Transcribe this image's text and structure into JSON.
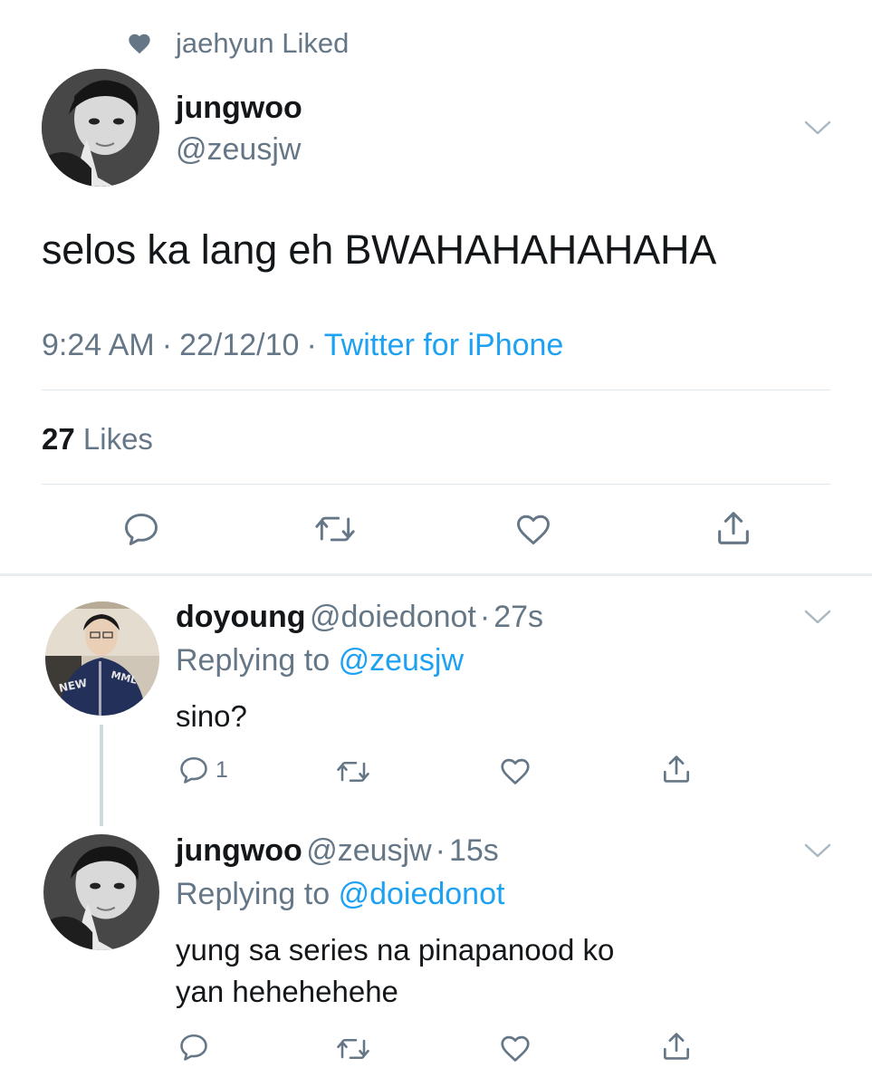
{
  "social_context": {
    "text": "jaehyun Liked",
    "icon": "heart-icon"
  },
  "main_tweet": {
    "name": "jungwoo",
    "handle": "@zeusjw",
    "text": "selos ka lang eh BWAHAHAHAHAHA",
    "time": "9:24 AM",
    "date": "22/12/10",
    "separator": "·",
    "source": "Twitter for iPhone",
    "likes_count": "27",
    "likes_label": "Likes"
  },
  "replies": [
    {
      "name": "doyoung",
      "handle": "@doiedonot",
      "sep": "·",
      "time": "27s",
      "replying_label": "Replying to",
      "replying_to": "@zeusjw",
      "text": "sino?",
      "reply_count": "1",
      "avatar_text_left": "NEW",
      "avatar_text_right": "MML"
    },
    {
      "name": "jungwoo",
      "handle": "@zeusjw",
      "sep": "·",
      "time": "15s",
      "replying_label": "Replying to",
      "replying_to": "@doiedonot",
      "text_line1": "yung sa series na pinapanood ko",
      "text_line2": "yan hehehehehe",
      "reply_count": ""
    }
  ],
  "colors": {
    "link": "#1da1f2",
    "secondary": "#657786",
    "divider": "#e1e8ed"
  }
}
